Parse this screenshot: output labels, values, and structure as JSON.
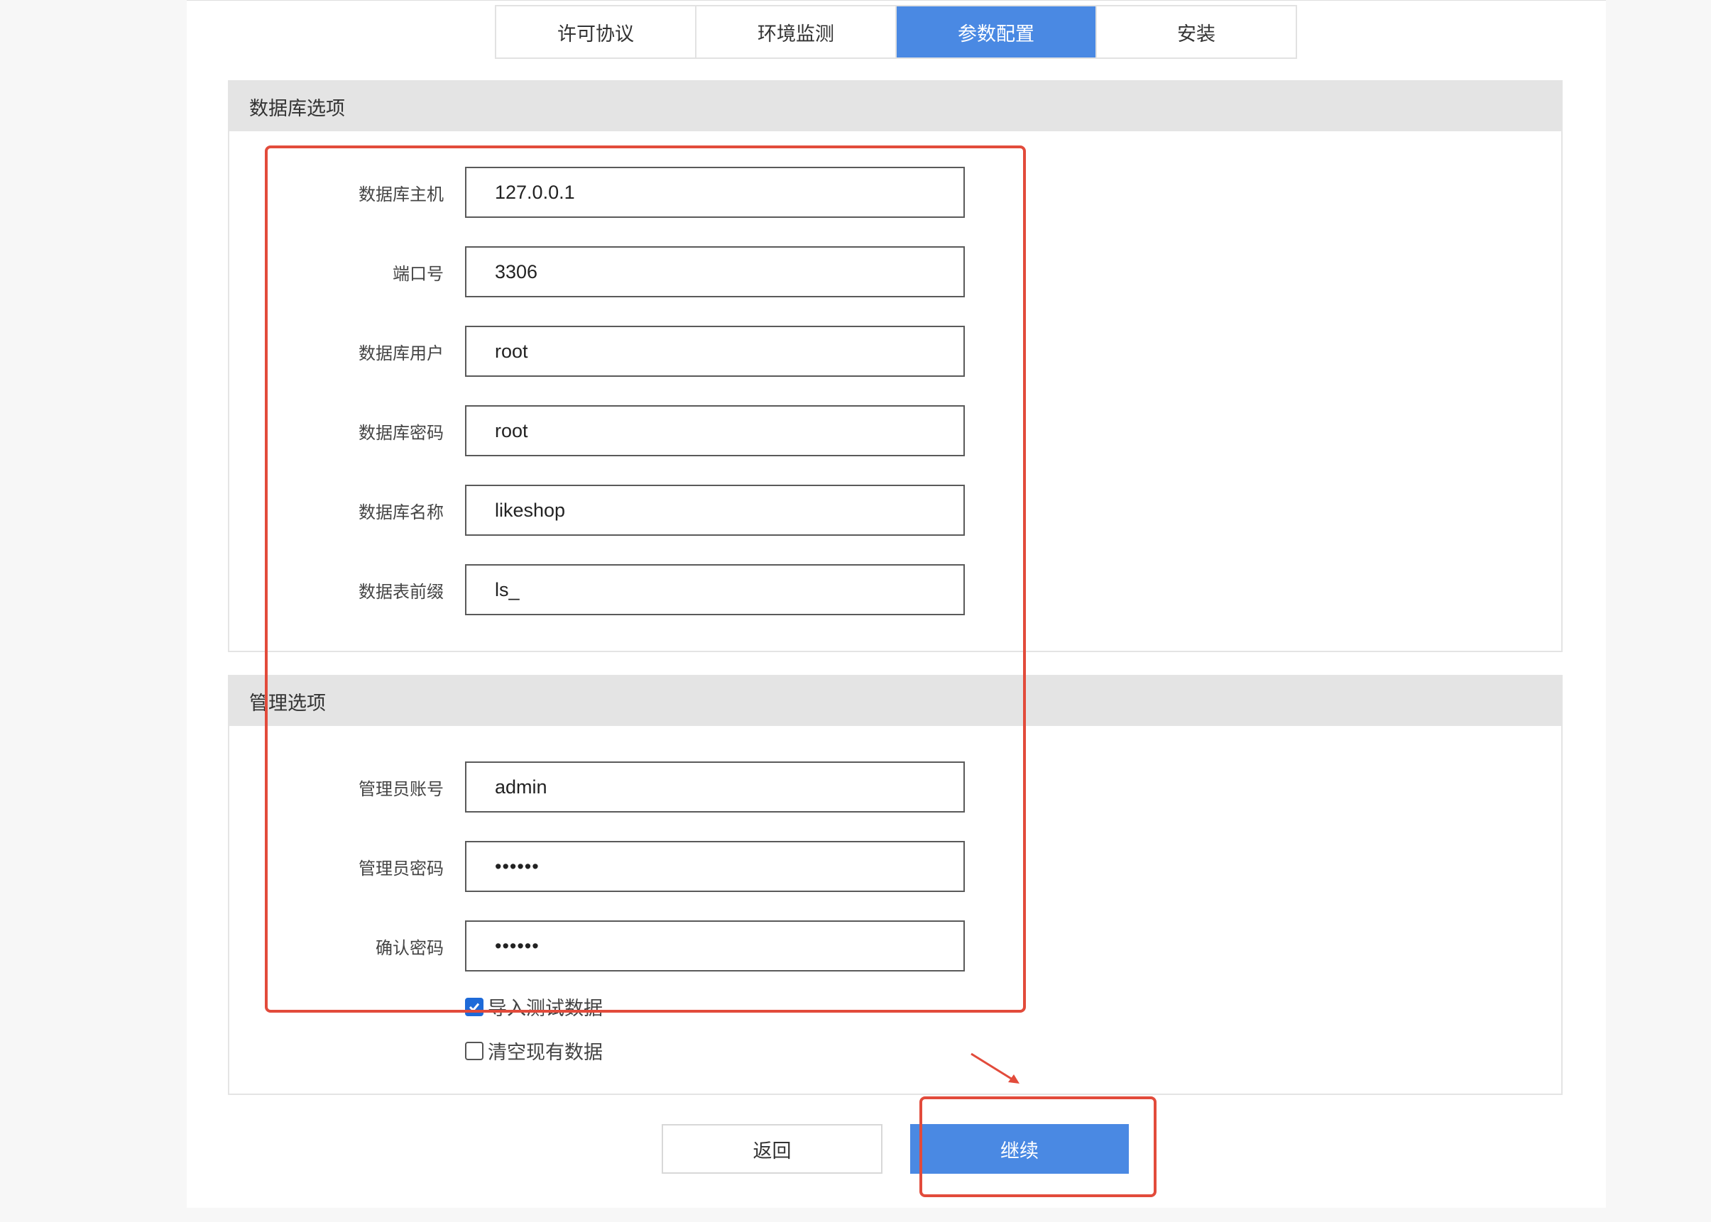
{
  "tabs": [
    {
      "label": "许可协议",
      "active": false
    },
    {
      "label": "环境监测",
      "active": false
    },
    {
      "label": "参数配置",
      "active": true
    },
    {
      "label": "安装",
      "active": false
    }
  ],
  "db_section": {
    "title": "数据库选项",
    "fields": [
      {
        "label": "数据库主机",
        "value": "127.0.0.1"
      },
      {
        "label": "端口号",
        "value": "3306"
      },
      {
        "label": "数据库用户",
        "value": "root"
      },
      {
        "label": "数据库密码",
        "value": "root"
      },
      {
        "label": "数据库名称",
        "value": "likeshop"
      },
      {
        "label": "数据表前缀",
        "value": "ls_"
      }
    ]
  },
  "admin_section": {
    "title": "管理选项",
    "fields": [
      {
        "label": "管理员账号",
        "value": "admin"
      },
      {
        "label": "管理员密码",
        "value": "••••••"
      },
      {
        "label": "确认密码",
        "value": "••••••"
      }
    ],
    "options": [
      {
        "label": "导入测试数据",
        "checked": true
      },
      {
        "label": "清空现有数据",
        "checked": false
      }
    ]
  },
  "buttons": {
    "back": "返回",
    "continue": "继续"
  },
  "colors": {
    "accent": "#4a89e3",
    "annotation": "#e24b3b",
    "section_header": "#e4e4e4"
  }
}
